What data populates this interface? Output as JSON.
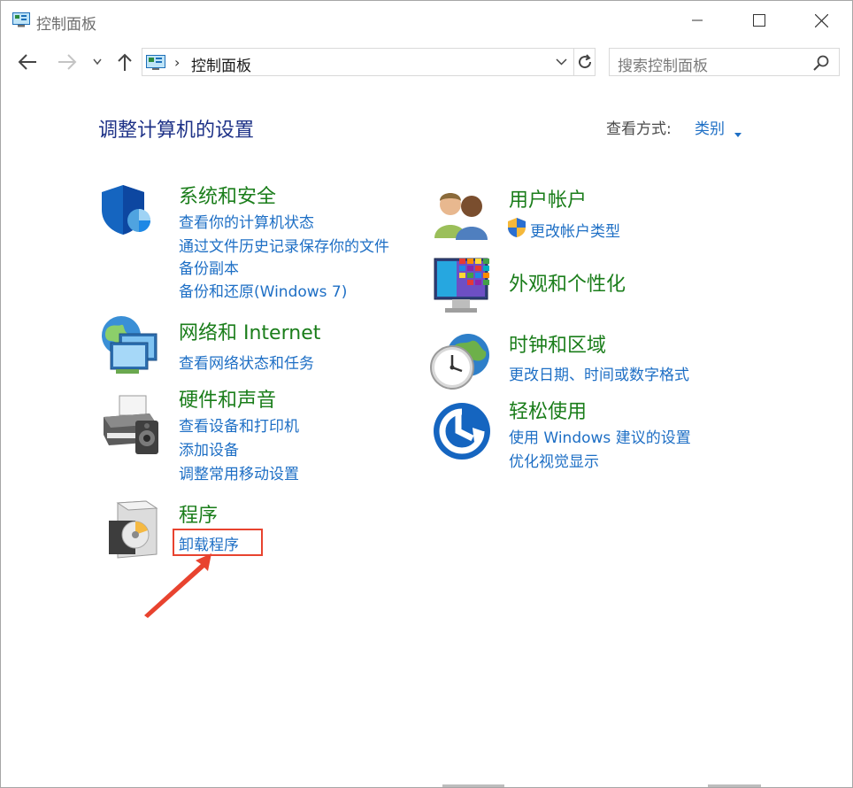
{
  "window": {
    "title": "控制面板"
  },
  "address": {
    "path": "控制面板",
    "separator": "›"
  },
  "search": {
    "placeholder": "搜索控制面板"
  },
  "page": {
    "heading": "调整计算机的设置",
    "view_label": "查看方式:",
    "view_value": "类别"
  },
  "categories": {
    "system": {
      "title": "系统和安全",
      "links": [
        "查看你的计算机状态",
        "通过文件历史记录保存你的文件",
        "备份副本",
        "备份和还原(Windows 7)"
      ],
      "icon": "shield-icon"
    },
    "network": {
      "title": "网络和 Internet",
      "links": [
        "查看网络状态和任务"
      ],
      "icon": "network-icon"
    },
    "hardware": {
      "title": "硬件和声音",
      "links": [
        "查看设备和打印机",
        "添加设备",
        "调整常用移动设置"
      ],
      "icon": "printer-icon"
    },
    "programs": {
      "title": "程序",
      "links": [
        "卸载程序"
      ],
      "icon": "programs-icon"
    },
    "users": {
      "title": "用户帐户",
      "links": [
        "更改帐户类型"
      ],
      "icon": "users-icon"
    },
    "appearance": {
      "title": "外观和个性化",
      "links": [],
      "icon": "monitor-icon"
    },
    "clock": {
      "title": "时钟和区域",
      "links": [
        "更改日期、时间或数字格式"
      ],
      "icon": "clock-globe-icon"
    },
    "ease": {
      "title": "轻松使用",
      "links": [
        "使用 Windows 建议的设置",
        "优化视觉显示"
      ],
      "icon": "ease-of-access-icon"
    }
  },
  "colors": {
    "title_green": "#1a7d1a",
    "link_blue": "#1e6fc5",
    "heading_blue": "#1e3287",
    "highlight_red": "#e8432f"
  }
}
